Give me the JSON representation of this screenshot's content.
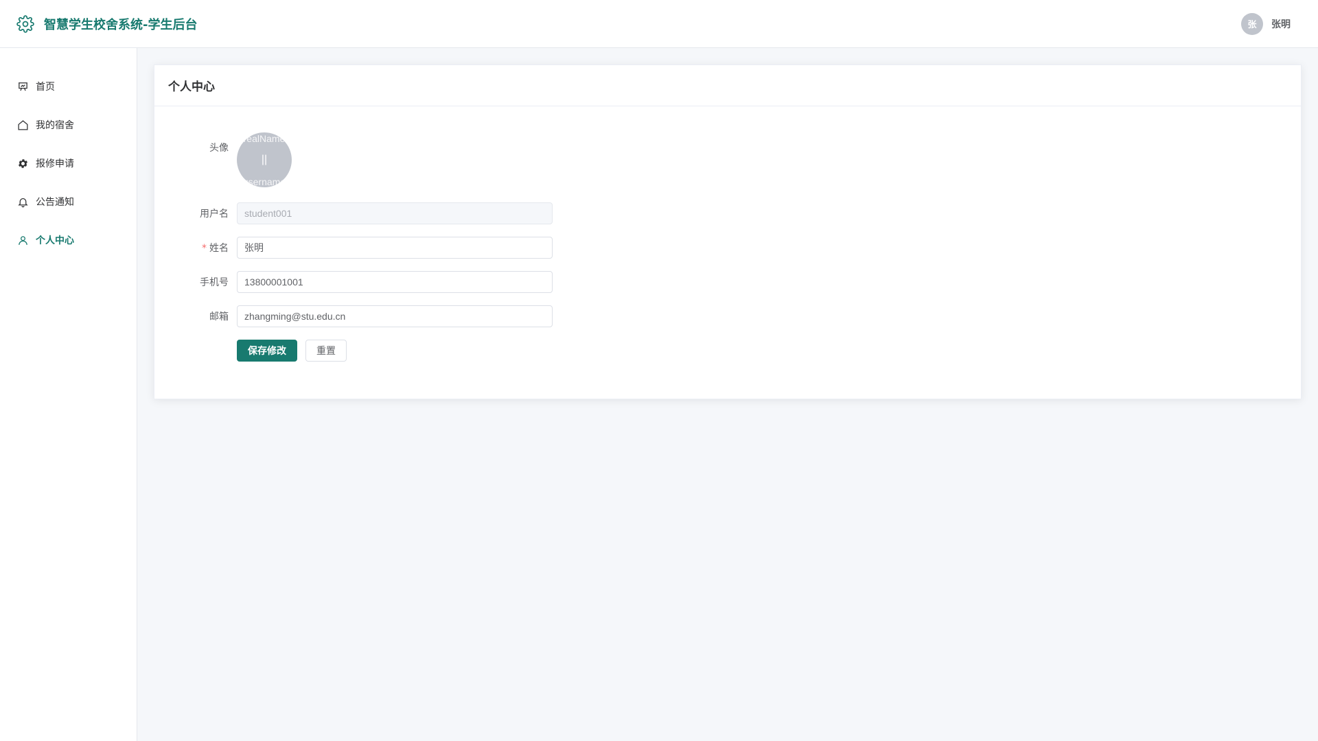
{
  "app": {
    "title": "智慧学生校舍系统-学生后台",
    "brand_icon": "gear-icon",
    "accent_color": "#187a6f"
  },
  "user": {
    "avatar_text": "张",
    "name": "张明"
  },
  "sidebar": {
    "items": [
      {
        "label": "首页",
        "icon": "presentation-icon",
        "active": false
      },
      {
        "label": "我的宿舍",
        "icon": "house-icon",
        "active": false
      },
      {
        "label": "报修申请",
        "icon": "gear-icon",
        "active": false
      },
      {
        "label": "公告通知",
        "icon": "bell-icon",
        "active": false
      },
      {
        "label": "个人中心",
        "icon": "user-icon",
        "active": true
      }
    ]
  },
  "page": {
    "title": "个人中心"
  },
  "form": {
    "avatar": {
      "label": "头像",
      "placeholder_top": "realName",
      "placeholder_mid": "||",
      "placeholder_bottom": "username"
    },
    "username": {
      "label": "用户名",
      "value": "student001"
    },
    "realname": {
      "label": "姓名",
      "value": "张明",
      "required_mark": "*"
    },
    "phone": {
      "label": "手机号",
      "value": "13800001001"
    },
    "email": {
      "label": "邮箱",
      "value": "zhangming@stu.edu.cn"
    },
    "save_label": "保存修改",
    "reset_label": "重置"
  }
}
